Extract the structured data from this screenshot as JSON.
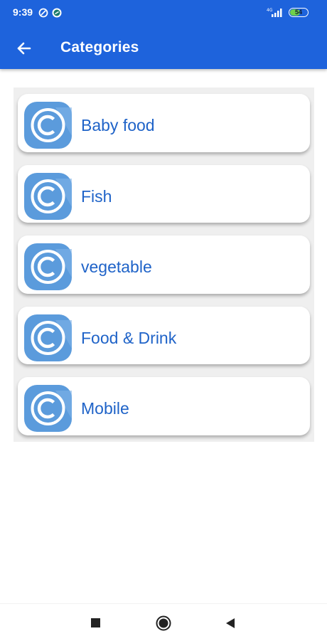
{
  "status_bar": {
    "time": "9:39",
    "network": "4G",
    "battery_level": "54"
  },
  "app_bar": {
    "title": "Categories",
    "back_icon": "arrow-left-icon"
  },
  "categories": [
    {
      "label": "Baby food",
      "icon": "copyright-icon"
    },
    {
      "label": "Fish",
      "icon": "copyright-icon"
    },
    {
      "label": "vegetable",
      "icon": "copyright-icon"
    },
    {
      "label": "Food & Drink",
      "icon": "copyright-icon"
    },
    {
      "label": "Mobile",
      "icon": "copyright-icon"
    }
  ],
  "nav_bar": {
    "icons": [
      "recents-square-icon",
      "home-circle-icon",
      "back-triangle-icon"
    ]
  },
  "colors": {
    "primary": "#1E63DC",
    "label": "#1F63C8",
    "icon_bg": "#5B9BDC"
  }
}
